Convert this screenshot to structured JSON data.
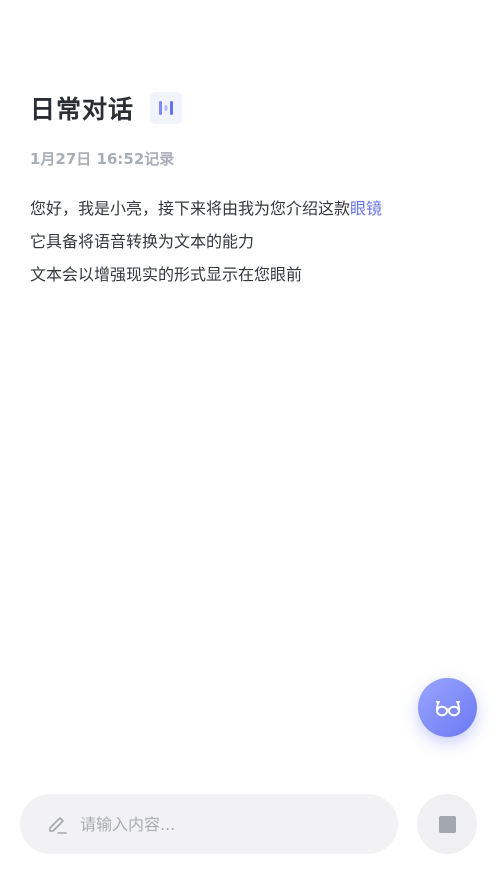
{
  "header": {
    "title": "日常对话",
    "voice_icon": "voice-wave-icon"
  },
  "record": {
    "timestamp": "1月27日 16:52记录"
  },
  "transcript": {
    "line1_text": "您好，我是小亮，接下来将由我为您介绍这款",
    "line1_highlight": "眼镜",
    "line2": "它具备将语音转换为文本的能力",
    "line3": "文本会以增强现实的形式显示在您眼前"
  },
  "fab": {
    "icon": "glasses-icon"
  },
  "input": {
    "value": "",
    "placeholder": "请输入内容...",
    "icon": "edit-icon"
  },
  "stop": {
    "icon": "stop-icon"
  },
  "colors": {
    "accent": "#6472f0",
    "title": "#2b2f33",
    "muted": "#a9aeb6",
    "input_bg": "#f2f2f4"
  }
}
